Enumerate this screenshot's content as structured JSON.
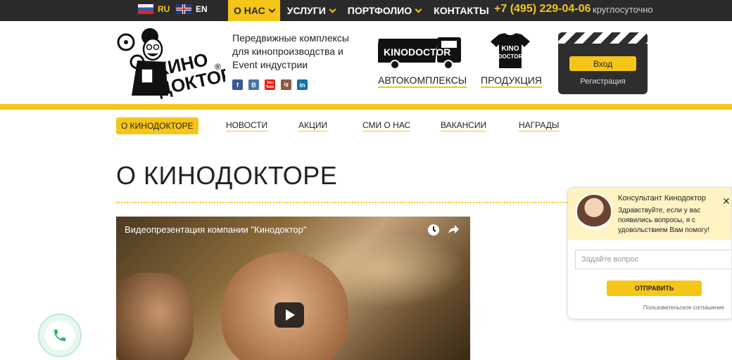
{
  "topbar": {
    "languages": [
      {
        "code": "RU",
        "flag": "ru"
      },
      {
        "code": "EN",
        "flag": "uk"
      }
    ],
    "nav": [
      {
        "label": "О НАС",
        "has_dropdown": true,
        "active": true
      },
      {
        "label": "УСЛУГИ",
        "has_dropdown": true,
        "active": false
      },
      {
        "label": "ПОРТФОЛИО",
        "has_dropdown": true,
        "active": false
      },
      {
        "label": "КОНТАКТЫ",
        "has_dropdown": false,
        "active": false
      }
    ],
    "phone": "+7 (495) 229-04-06",
    "hours": "круглосуточно"
  },
  "header": {
    "logo_text": "КИНО ДОКТОР",
    "registered_mark": "®",
    "tagline": "Передвижные комплексы для кинопроизводства и Event индустрии",
    "socials": [
      "f",
      "В",
      "You Tube",
      "ig",
      "in"
    ],
    "products": [
      {
        "label": "АВТОКОМПЛЕКСЫ",
        "image_text": "KINODOCTOR"
      },
      {
        "label": "ПРОДУКЦИЯ",
        "image_text": "KINO DOCTOR"
      }
    ],
    "login_label": "Вход",
    "register_label": "Регистрация"
  },
  "subnav": [
    {
      "label": "О КИНОДОКТОРЕ",
      "active": true
    },
    {
      "label": "НОВОСТИ",
      "active": false
    },
    {
      "label": "АКЦИИ",
      "active": false
    },
    {
      "label": "СМИ О НАС",
      "active": false
    },
    {
      "label": "ВАКАНСИИ",
      "active": false
    },
    {
      "label": "НАГРАДЫ",
      "active": false
    }
  ],
  "page_title": "О КИНОДОКТОРЕ",
  "video": {
    "title": "Видеопрезентация компании \"Кинодоктор\""
  },
  "chat": {
    "name": "Консультант Кинодоктор",
    "message": "Здравствуйте, если у вас появились вопросы, я с удовольствием Вам помогу!",
    "input_placeholder": "Задайте вопрос",
    "send_label": "ОТПРАВИТЬ",
    "agreement": "Пользовательское соглашение"
  },
  "colors": {
    "accent": "#f5c518",
    "dark": "#2b2b2b"
  }
}
